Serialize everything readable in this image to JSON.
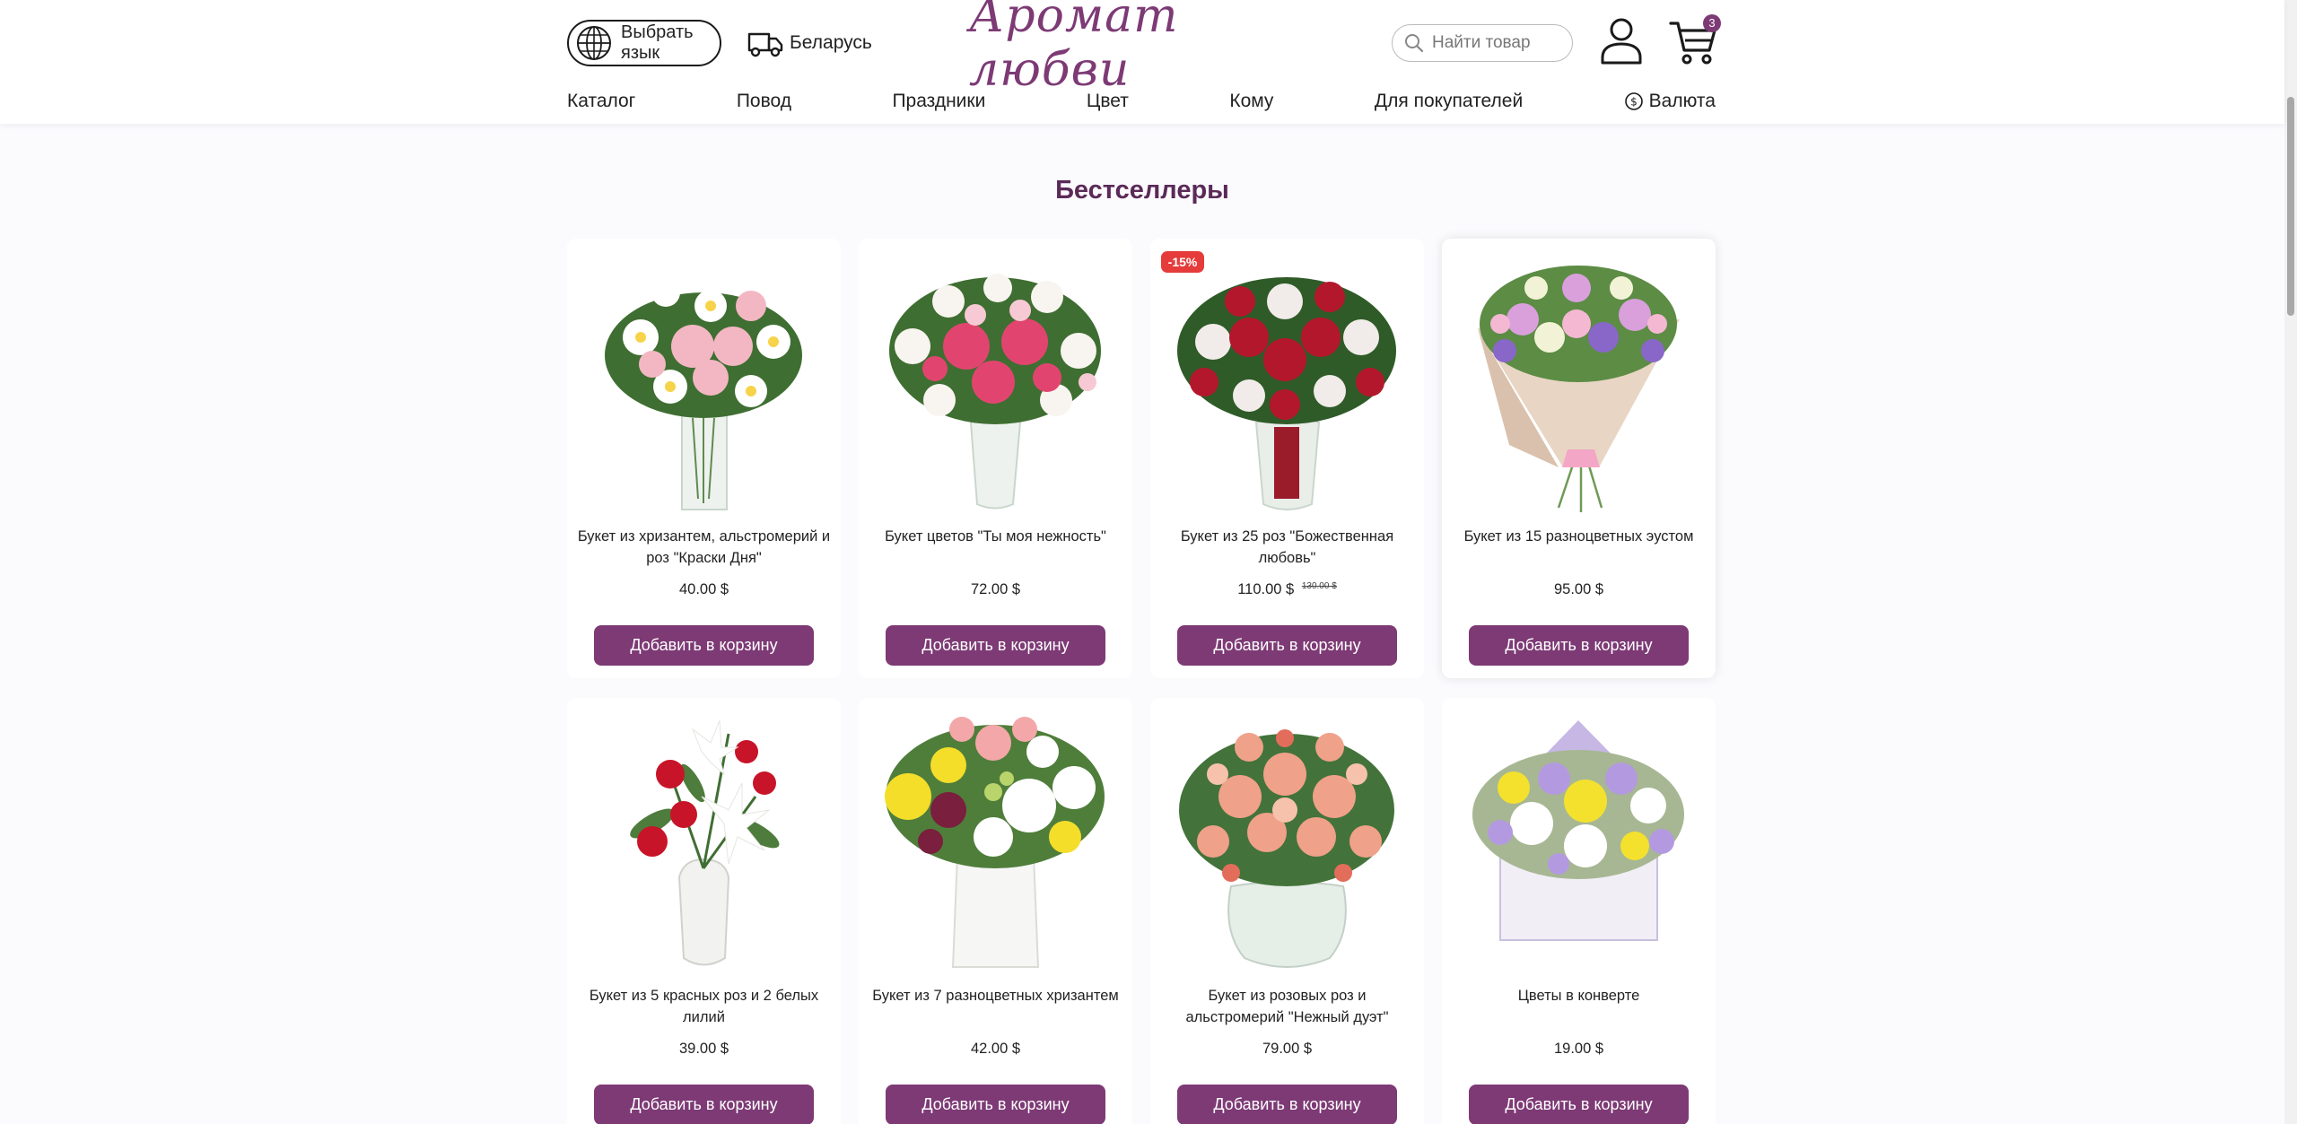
{
  "header": {
    "language_button": "Выбрать язык",
    "region": "Беларусь",
    "logo": "Аромат любви",
    "search_placeholder": "Найти товар",
    "cart_count": "3"
  },
  "nav": {
    "items": [
      "Каталог",
      "Повод",
      "Праздники",
      "Цвет",
      "Кому",
      "Для покупателей"
    ],
    "currency": "Валюта"
  },
  "section_title": "Бестселлеры",
  "add_to_cart_label": "Добавить в корзину",
  "products": [
    {
      "name": "Букет из хризантем, альстромерий и роз \"Краски Дня\"",
      "price": "40.00 $",
      "old_price": "",
      "discount": ""
    },
    {
      "name": "Букет цветов \"Ты моя нежность\"",
      "price": "72.00 $",
      "old_price": "",
      "discount": ""
    },
    {
      "name": "Букет из 25 роз \"Божественная любовь\"",
      "price": "110.00 $",
      "old_price": "130.00 $",
      "discount": "-15%"
    },
    {
      "name": "Букет из 15 разноцветных эустом",
      "price": "95.00 $",
      "old_price": "",
      "discount": ""
    },
    {
      "name": "Букет из 5 красных роз и 2 белых лилий",
      "price": "39.00 $",
      "old_price": "",
      "discount": ""
    },
    {
      "name": "Букет из 7 разноцветных хризантем",
      "price": "42.00 $",
      "old_price": "",
      "discount": ""
    },
    {
      "name": "Букет из розовых роз и альстромерий \"Нежный дуэт\"",
      "price": "79.00 $",
      "old_price": "",
      "discount": ""
    },
    {
      "name": "Цветы в конверте",
      "price": "19.00 $",
      "old_price": "",
      "discount": ""
    }
  ],
  "colors": {
    "brand": "#7d3a75",
    "title": "#5b2a58",
    "discount": "#e53b3b"
  }
}
